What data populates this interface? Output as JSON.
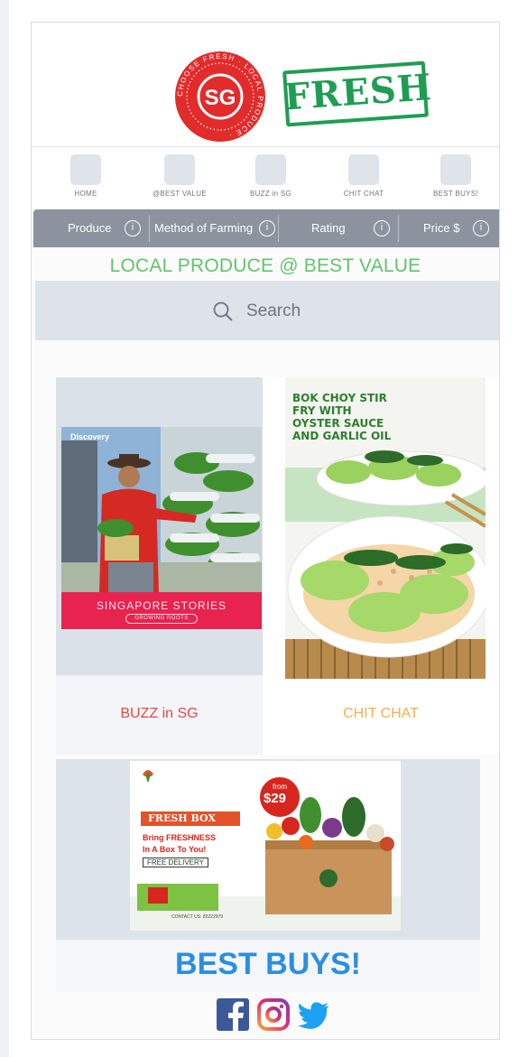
{
  "header": {
    "seal_text": "SG",
    "seal_ring_text": "CHOOSE FRESH · LOCAL PRODUCE ·",
    "brand_word": "FRESH"
  },
  "nav": {
    "items": [
      {
        "label": "HOME"
      },
      {
        "label": "@BEST VALUE"
      },
      {
        "label": "BUZZ in SG"
      },
      {
        "label": "CHIT CHAT"
      },
      {
        "label": "BEST BUYS!"
      }
    ]
  },
  "filters": [
    {
      "label": "Produce",
      "info": "i"
    },
    {
      "label": "Method of Farming",
      "info": "i"
    },
    {
      "label": "Rating",
      "info": "i"
    },
    {
      "label": "Price $",
      "info": "i"
    }
  ],
  "title": "LOCAL PRODUCE @ BEST VALUE",
  "search": {
    "placeholder": "Search"
  },
  "tiles": {
    "buzz": {
      "label": "BUZZ in SG",
      "logo": "Discovery",
      "caption": "SINGAPORE STORIES",
      "caption_sub": "GROWING ROOTS"
    },
    "chit": {
      "label": "CHIT CHAT",
      "recipe_title": "BOK CHOY STIR FRY WITH OYSTER SAUCE AND GARLIC OIL"
    }
  },
  "best_buys": {
    "label": "BEST BUYS!",
    "ad": {
      "brand": "FRESH BOX",
      "headline_1": "Bring FRESHNESS",
      "headline_2": "In A Box To You!",
      "badge_from": "from",
      "price": "$29",
      "delivery": "FREE DELIVERY",
      "contact": "CONTACT US: 82222979"
    }
  },
  "social": [
    "facebook",
    "instagram",
    "twitter"
  ],
  "colors": {
    "title_green": "#62c46b",
    "buzz_red": "#e64848",
    "chit_orange": "#f5b04a",
    "bestbuys_blue": "#2b8fe0",
    "filter_gray": "#8a939e",
    "seal_red": "#e22b2b",
    "stamp_green": "#1f9d53"
  }
}
